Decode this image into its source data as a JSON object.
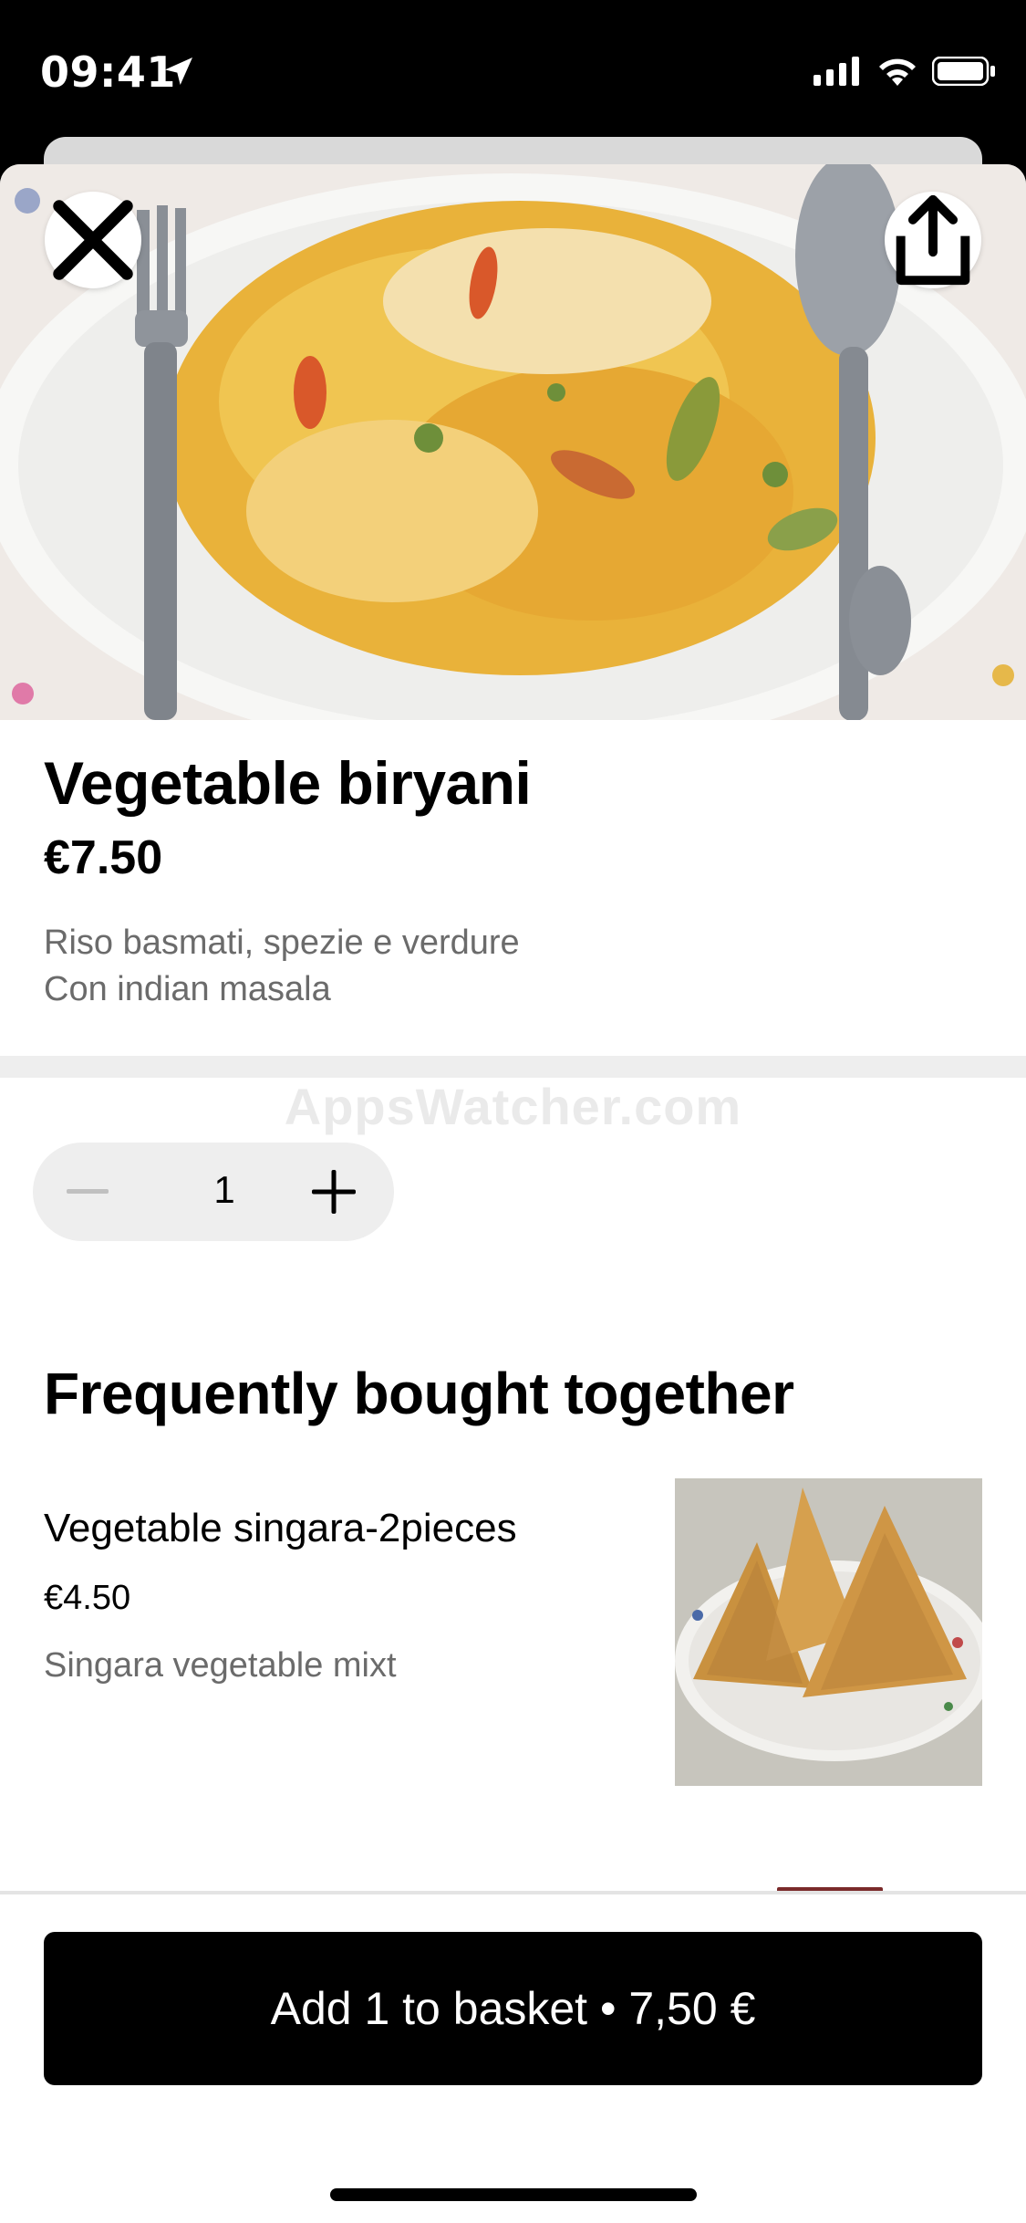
{
  "status_bar": {
    "time": "09:41",
    "icons": [
      "location-arrow-icon",
      "cellular-signal-icon",
      "wifi-icon",
      "battery-icon"
    ]
  },
  "header": {
    "close_icon": "close-icon",
    "share_icon": "share-icon"
  },
  "item": {
    "title": "Vegetable biryani",
    "price": "€7.50",
    "description_line1": "Riso basmati, spezie e verdure",
    "description_line2": "Con indian masala"
  },
  "watermark": "AppsWatcher.com",
  "quantity": {
    "value": "1",
    "minus_icon": "minus-icon",
    "plus_icon": "plus-icon"
  },
  "recommendations": {
    "title": "Frequently bought together",
    "items": [
      {
        "name": "Vegetable singara-2pieces",
        "price": "€4.50",
        "description": "Singara vegetable mixt"
      }
    ]
  },
  "cta": {
    "label": "Add 1 to basket • 7,50 €"
  },
  "colors": {
    "primary": "#000000",
    "secondary_text": "#6b6b6b",
    "divider": "#eeeeee",
    "background": "#ffffff"
  }
}
